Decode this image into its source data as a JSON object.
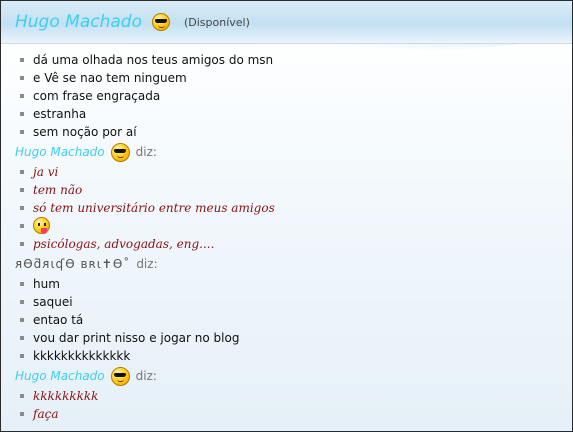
{
  "header": {
    "name": "Hugo Machado",
    "status": "(Disponível)",
    "emoticon": "sunglasses-smiley-icon"
  },
  "colors": {
    "name_blue": "#3fd0ee",
    "script_red": "#8b1212"
  },
  "conversation": [
    {
      "sender": "",
      "says": "",
      "messages": [
        "dá uma olhada nos teus amigos do msn",
        "e Vê se nao tem ninguem",
        "com frase engraçada",
        "estranha",
        "sem noção por aí"
      ]
    },
    {
      "sender": "Hugo Machado",
      "says": "diz:",
      "messages": [
        "ja vi",
        "tem não",
        "só tem universitário entre meus amigos",
        "",
        "psicólogas, advogadas, eng...."
      ]
    },
    {
      "sender": "ᴙѲƌᴙɩʠѲ ʙʀɩ✝Ѳ˚",
      "says": "diz:",
      "messages": [
        "hum",
        "saquei",
        "entao tá",
        "vou dar print nisso e jogar no blog",
        "kkkkkkkkkkkkkk"
      ]
    },
    {
      "sender": "Hugo Machado",
      "says": "diz:",
      "messages": [
        "kkkkkkkkk",
        "faça"
      ]
    }
  ]
}
